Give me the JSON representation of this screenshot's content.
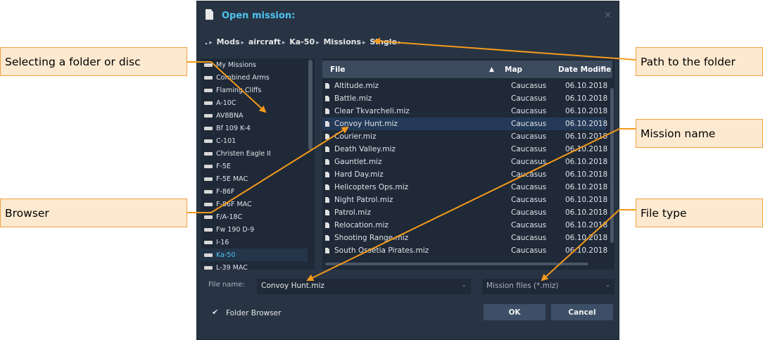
{
  "dialog": {
    "title": "Open mission:",
    "close": "×",
    "breadcrumb": [
      ".",
      "Mods",
      "aircraft",
      "Ka-50",
      "Missions",
      "Single"
    ],
    "browser": {
      "items": [
        {
          "label": "My Missions",
          "selected": false
        },
        {
          "label": "Combined Arms",
          "selected": false
        },
        {
          "label": "Flaming Cliffs",
          "selected": false
        },
        {
          "label": "A-10C",
          "selected": false
        },
        {
          "label": "AV8BNA",
          "selected": false
        },
        {
          "label": "Bf 109 K-4",
          "selected": false
        },
        {
          "label": "C-101",
          "selected": false
        },
        {
          "label": "Christen Eagle II",
          "selected": false
        },
        {
          "label": "F-5E",
          "selected": false
        },
        {
          "label": "F-5E MAC",
          "selected": false
        },
        {
          "label": "F-86F",
          "selected": false
        },
        {
          "label": "F-86F MAC",
          "selected": false
        },
        {
          "label": "F/A-18C",
          "selected": false
        },
        {
          "label": "Fw 190 D-9",
          "selected": false
        },
        {
          "label": "I-16",
          "selected": false
        },
        {
          "label": "Ka-50",
          "selected": true
        },
        {
          "label": "L-39 MAC",
          "selected": false
        }
      ]
    },
    "files": {
      "columns": [
        "File",
        "Map",
        "Date Modifie"
      ],
      "sort_indicator": "▲",
      "rows": [
        {
          "name": "Altitude.miz",
          "map": "Caucasus",
          "date": "06.10.2018",
          "selected": false
        },
        {
          "name": "Battle.miz",
          "map": "Caucasus",
          "date": "06.10.2018",
          "selected": false
        },
        {
          "name": "Clear Tkvarcheli.miz",
          "map": "Caucasus",
          "date": "06.10.2018",
          "selected": false
        },
        {
          "name": "Convoy Hunt.miz",
          "map": "Caucasus",
          "date": "06.10.2018",
          "selected": true
        },
        {
          "name": "Courier.miz",
          "map": "Caucasus",
          "date": "06.10.2018",
          "selected": false
        },
        {
          "name": "Death Valley.miz",
          "map": "Caucasus",
          "date": "06.10.2018",
          "selected": false
        },
        {
          "name": "Gauntlet.miz",
          "map": "Caucasus",
          "date": "06.10.2018",
          "selected": false
        },
        {
          "name": "Hard Day.miz",
          "map": "Caucasus",
          "date": "06.10.2018",
          "selected": false
        },
        {
          "name": "Helicopters Ops.miz",
          "map": "Caucasus",
          "date": "06.10.2018",
          "selected": false
        },
        {
          "name": "Night Patrol.miz",
          "map": "Caucasus",
          "date": "06.10.2018",
          "selected": false
        },
        {
          "name": "Patrol.miz",
          "map": "Caucasus",
          "date": "06.10.2018",
          "selected": false
        },
        {
          "name": "Relocation.miz",
          "map": "Caucasus",
          "date": "06.10.2018",
          "selected": false
        },
        {
          "name": "Shooting Range.miz",
          "map": "Caucasus",
          "date": "06.10.2018",
          "selected": false
        },
        {
          "name": "South Ossetia Pirates.miz",
          "map": "Caucasus",
          "date": "06.10.2018",
          "selected": false
        }
      ]
    },
    "file_name": {
      "label": "File name:",
      "value": "Convoy Hunt.miz"
    },
    "file_type": {
      "value": "Mission files (*.miz)"
    },
    "folder_browser": {
      "label": "Folder Browser",
      "checked": true
    },
    "ok": "OK",
    "cancel": "Cancel"
  },
  "callouts": {
    "select_folder": "Selecting a folder or disc",
    "browser": "Browser",
    "path": "Path to the folder",
    "mission_name": "Mission name",
    "file_type": "File type"
  },
  "colors": {
    "dialog_bg": "#283444",
    "panel_bg": "#1f2937",
    "accent": "#4fc3ef",
    "callout_bg": "#fde9d0",
    "callout_border": "#f0a040",
    "arrow": "#f39a1b"
  }
}
